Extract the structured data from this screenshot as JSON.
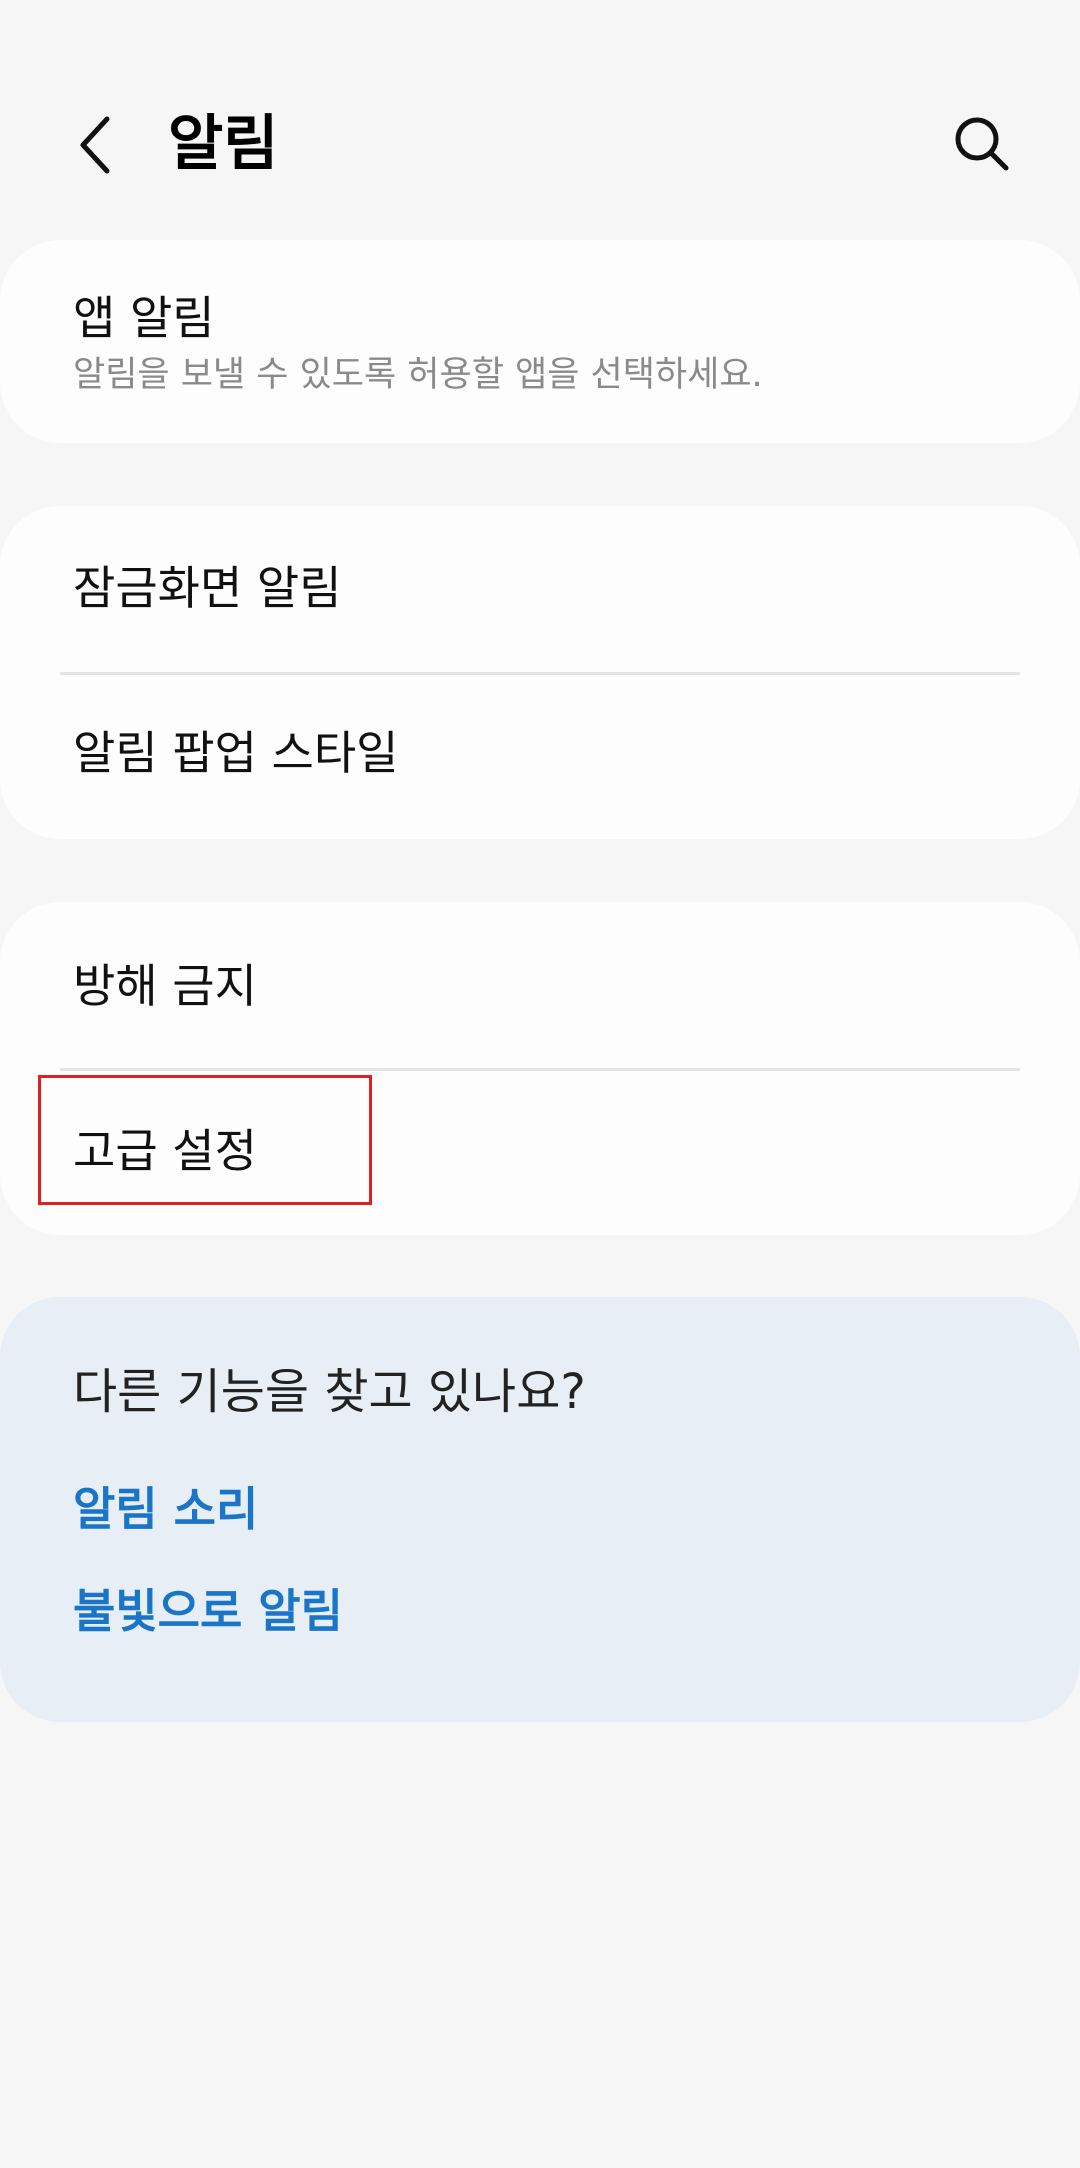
{
  "header": {
    "title": "알림",
    "back_icon": "chevron-left-icon",
    "search_icon": "search-icon"
  },
  "app_notifications": {
    "title": "앱 알림",
    "subtitle": "알림을 보낼 수 있도록 허용할 앱을 선택하세요."
  },
  "lock_group": {
    "items": [
      {
        "label": "잠금화면 알림"
      },
      {
        "label": "알림 팝업 스타일"
      }
    ]
  },
  "dnd_group": {
    "items": [
      {
        "label": "방해 금지"
      },
      {
        "label": "고급 설정"
      }
    ]
  },
  "suggestions": {
    "heading": "다른 기능을 찾고 있나요?",
    "links": [
      {
        "label": "알림 소리"
      },
      {
        "label": "불빛으로 알림"
      }
    ]
  },
  "colors": {
    "background": "#f6f6f6",
    "card": "#fdfdfd",
    "suggestion_card": "#e7eef6",
    "link": "#1a74c8",
    "highlight": "#e02020"
  }
}
